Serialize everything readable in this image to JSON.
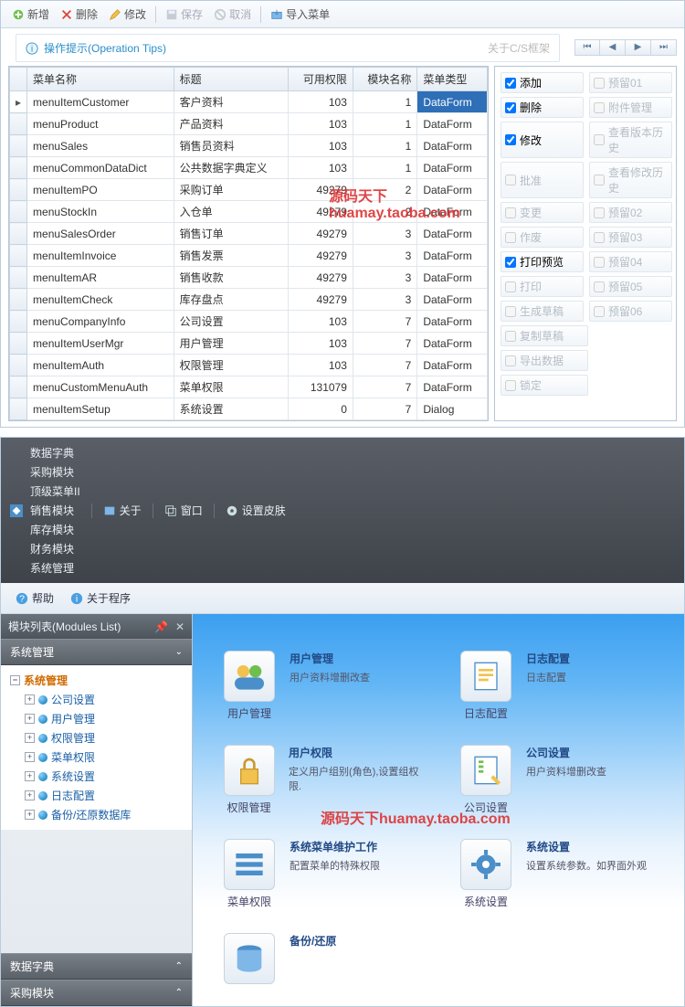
{
  "toolbar": {
    "add": "新增",
    "delete": "删除",
    "edit": "修改",
    "save": "保存",
    "cancel": "取消",
    "import": "导入菜单"
  },
  "tips": {
    "label": "操作提示(Operation Tips)",
    "about": "关于C/S框架"
  },
  "grid": {
    "headers": {
      "name": "菜单名称",
      "title": "标题",
      "perm": "可用权限",
      "module": "模块名称",
      "type": "菜单类型"
    },
    "rows": [
      {
        "name": "menuItemCustomer",
        "title": "客户资料",
        "perm": 103,
        "module": 1,
        "type": "DataForm",
        "sel": true
      },
      {
        "name": "menuProduct",
        "title": "产品资料",
        "perm": 103,
        "module": 1,
        "type": "DataForm"
      },
      {
        "name": "menuSales",
        "title": "销售员资料",
        "perm": 103,
        "module": 1,
        "type": "DataForm"
      },
      {
        "name": "menuCommonDataDict",
        "title": "公共数据字典定义",
        "perm": 103,
        "module": 1,
        "type": "DataForm"
      },
      {
        "name": "menuItemPO",
        "title": "采购订单",
        "perm": 49279,
        "module": 2,
        "type": "DataForm"
      },
      {
        "name": "menuStockIn",
        "title": "入仓单",
        "perm": 49279,
        "module": 2,
        "type": "DataForm"
      },
      {
        "name": "menuSalesOrder",
        "title": "销售订单",
        "perm": 49279,
        "module": 3,
        "type": "DataForm"
      },
      {
        "name": "menuItemInvoice",
        "title": "销售发票",
        "perm": 49279,
        "module": 3,
        "type": "DataForm"
      },
      {
        "name": "menuItemAR",
        "title": "销售收款",
        "perm": 49279,
        "module": 3,
        "type": "DataForm"
      },
      {
        "name": "menuItemCheck",
        "title": "库存盘点",
        "perm": 49279,
        "module": 3,
        "type": "DataForm"
      },
      {
        "name": "menuCompanyInfo",
        "title": "公司设置",
        "perm": 103,
        "module": 7,
        "type": "DataForm"
      },
      {
        "name": "menuItemUserMgr",
        "title": "用户管理",
        "perm": 103,
        "module": 7,
        "type": "DataForm"
      },
      {
        "name": "menuItemAuth",
        "title": "权限管理",
        "perm": 103,
        "module": 7,
        "type": "DataForm"
      },
      {
        "name": "menuCustomMenuAuth",
        "title": "菜单权限",
        "perm": 131079,
        "module": 7,
        "type": "DataForm"
      },
      {
        "name": "menuItemSetup",
        "title": "系统设置",
        "perm": 0,
        "module": 7,
        "type": "Dialog"
      }
    ]
  },
  "checks": {
    "left": [
      {
        "label": "添加",
        "on": true
      },
      {
        "label": "删除",
        "on": true
      },
      {
        "label": "修改",
        "on": true
      },
      {
        "label": "批准",
        "dis": true
      },
      {
        "label": "变更",
        "dis": true
      },
      {
        "label": "作废",
        "dis": true
      },
      {
        "label": "打印预览",
        "on": true
      },
      {
        "label": "打印",
        "dis": true
      },
      {
        "label": "生成草稿",
        "dis": true
      },
      {
        "label": "复制草稿",
        "dis": true
      },
      {
        "label": "导出数据",
        "dis": true
      },
      {
        "label": "锁定",
        "dis": true
      }
    ],
    "right": [
      {
        "label": "预留01",
        "dis": true
      },
      {
        "label": "附件管理",
        "dis": true
      },
      {
        "label": "查看版本历史",
        "dis": true
      },
      {
        "label": "查看修改历史",
        "dis": true
      },
      {
        "label": "预留02",
        "dis": true
      },
      {
        "label": "预留03",
        "dis": true
      },
      {
        "label": "预留04",
        "dis": true
      },
      {
        "label": "预留05",
        "dis": true
      },
      {
        "label": "预留06",
        "dis": true
      }
    ]
  },
  "watermark": "源码天下huamay.taoba.com",
  "menu2": {
    "items": [
      "数据字典",
      "采购模块",
      "顶级菜单II",
      "销售模块",
      "库存模块",
      "财务模块",
      "系统管理"
    ],
    "about": "关于",
    "window": "窗口",
    "skin": "设置皮肤"
  },
  "help": {
    "help": "帮助",
    "about": "关于程序"
  },
  "panel": {
    "title": "模块列表(Modules List)"
  },
  "accordion": {
    "sysmgr": "系统管理",
    "datadict": "数据字典",
    "purchase": "采购模块"
  },
  "tree": {
    "root": "系统管理",
    "items": [
      "公司设置",
      "用户管理",
      "权限管理",
      "菜单权限",
      "系统设置",
      "日志配置",
      "备份/还原数据库"
    ]
  },
  "tiles": [
    {
      "icon": "users",
      "iconLabel": "用户管理",
      "title": "用户管理",
      "sub": "用户资料增删改查"
    },
    {
      "icon": "log",
      "iconLabel": "日志配置",
      "title": "日志配置",
      "sub": "日志配置"
    },
    {
      "icon": "lock",
      "iconLabel": "权限管理",
      "title": "用户权限",
      "sub": "定义用户组别(角色),设置组权限."
    },
    {
      "icon": "company",
      "iconLabel": "公司设置",
      "title": "公司设置",
      "sub": "用户资料增删改查"
    },
    {
      "icon": "menu",
      "iconLabel": "菜单权限",
      "title": "系统菜单维护工作",
      "sub": "配置菜单的特殊权限"
    },
    {
      "icon": "gear",
      "iconLabel": "系统设置",
      "title": "系统设置",
      "sub": "设置系统参数。如界面外观"
    },
    {
      "icon": "db",
      "iconLabel": "",
      "title": "备份/还原",
      "sub": ""
    }
  ]
}
